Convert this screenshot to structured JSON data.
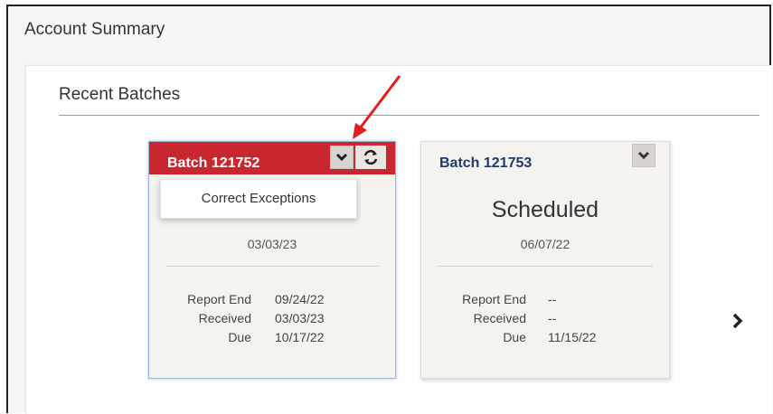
{
  "page": {
    "title": "Account Summary"
  },
  "section": {
    "title": "Recent Batches"
  },
  "cards": [
    {
      "batch_title": "Batch 121752",
      "header_color": "#c9272f",
      "menu_open": true,
      "menu_items": [
        "Correct Exceptions"
      ],
      "status": "",
      "status_date": "03/03/23",
      "details": [
        {
          "label": "Report End",
          "value": "09/24/22"
        },
        {
          "label": "Received",
          "value": "03/03/23"
        },
        {
          "label": "Due",
          "value": "10/17/22"
        }
      ],
      "icons": [
        "chevron-down-icon",
        "sync-icon"
      ]
    },
    {
      "batch_title": "Batch 121753",
      "menu_open": false,
      "status": "Scheduled",
      "status_date": "06/07/22",
      "details": [
        {
          "label": "Report End",
          "value": "--"
        },
        {
          "label": "Received",
          "value": "--"
        },
        {
          "label": "Due",
          "value": "11/15/22"
        }
      ],
      "icons": [
        "chevron-down-icon"
      ]
    }
  ],
  "colors": {
    "accent_red": "#c9272f",
    "batch_title_blue": "#1f3a6b",
    "annotation_arrow": "#e02020"
  }
}
